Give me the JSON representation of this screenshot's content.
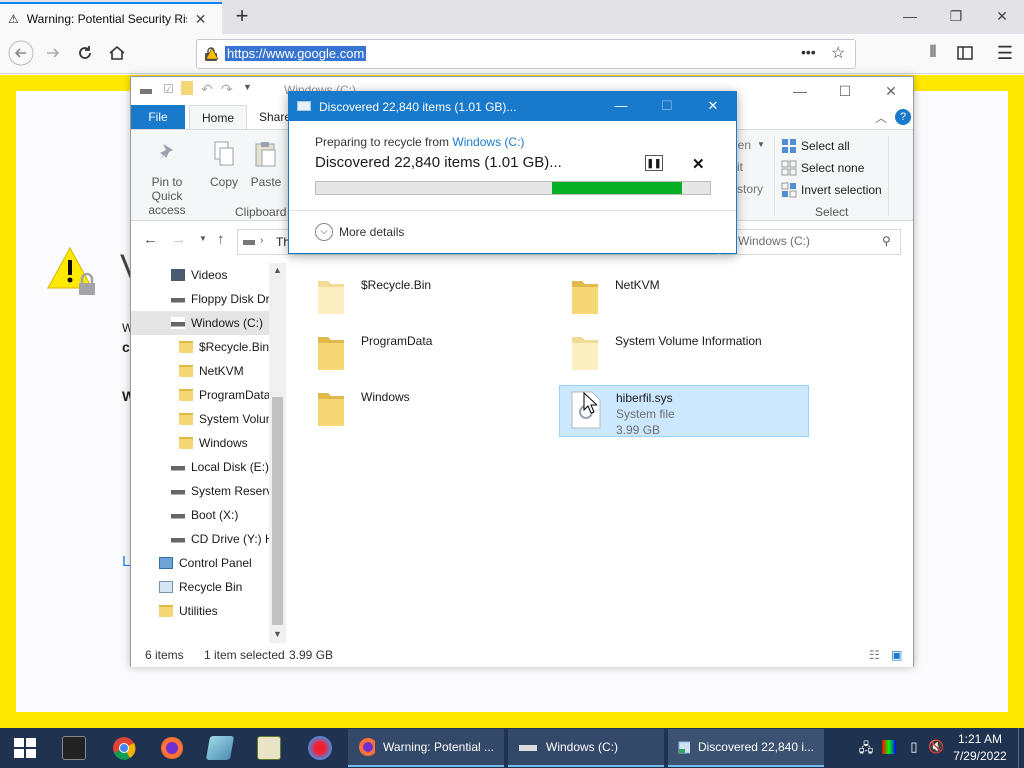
{
  "browser": {
    "tab_title": "Warning: Potential Security Risk Ahead",
    "url": "https://www.google.com"
  },
  "warning_page": {
    "fragments": [
      "V",
      "W",
      "c",
      "W",
      "L"
    ]
  },
  "explorer": {
    "title": "Windows (C:)",
    "ribbon_tabs": [
      "File",
      "Home",
      "Share"
    ],
    "clipboard": {
      "pin_label": "Pin to Quick access",
      "copy_label": "Copy",
      "paste_label": "Paste",
      "group_label": "Clipboard"
    },
    "select": {
      "select_all": "Select all",
      "select_none": "Select none",
      "invert": "Invert selection",
      "group_label": "Select",
      "partial_open": "pen",
      "partial_edit": "it",
      "partial_history": "story"
    },
    "address_partial": "Th",
    "search_placeholder": "h Windows (C:)",
    "tree": [
      {
        "label": "Videos",
        "icon": "videos-icon",
        "indent": 1
      },
      {
        "label": "Floppy Disk Dri",
        "icon": "floppy-icon",
        "indent": 1
      },
      {
        "label": "Windows (C:)",
        "icon": "drive-icon",
        "indent": 1,
        "selected": true
      },
      {
        "label": "$Recycle.Bin",
        "icon": "folder-icon",
        "indent": 2
      },
      {
        "label": "NetKVM",
        "icon": "folder-icon",
        "indent": 2
      },
      {
        "label": "ProgramData",
        "icon": "folder-icon",
        "indent": 2
      },
      {
        "label": "System Volun",
        "icon": "folder-icon",
        "indent": 2
      },
      {
        "label": "Windows",
        "icon": "folder-icon",
        "indent": 2
      },
      {
        "label": "Local Disk (E:)",
        "icon": "drive-icon",
        "indent": 1
      },
      {
        "label": "System Reserve",
        "icon": "drive-icon",
        "indent": 1
      },
      {
        "label": "Boot (X:)",
        "icon": "drive-icon",
        "indent": 1
      },
      {
        "label": "CD Drive (Y:) H",
        "icon": "cd-drive-icon",
        "indent": 1
      },
      {
        "label": "Control Panel",
        "icon": "control-panel-icon",
        "indent": 0
      },
      {
        "label": "Recycle Bin",
        "icon": "recycle-bin-icon",
        "indent": 0
      },
      {
        "label": "Utilities",
        "icon": "folder-icon",
        "indent": 0
      }
    ],
    "files": [
      {
        "name": "$Recycle.Bin",
        "meta1": "",
        "meta2": ""
      },
      {
        "name": "NetKVM",
        "meta1": "",
        "meta2": ""
      },
      {
        "name": "ProgramData",
        "meta1": "",
        "meta2": ""
      },
      {
        "name": "System Volume Information",
        "meta1": "",
        "meta2": ""
      },
      {
        "name": "Windows",
        "meta1": "",
        "meta2": ""
      },
      {
        "name": "hiberfil.sys",
        "meta1": "System file",
        "meta2": "3.99 GB"
      }
    ],
    "status": {
      "count": "6 items",
      "selected": "1 item selected",
      "size": "3.99 GB"
    }
  },
  "dialog": {
    "title": "Discovered 22,840 items (1.01 GB)...",
    "preparing_prefix": "Preparing to recycle from ",
    "preparing_link": "Windows (C:)",
    "main_text": "Discovered 22,840 items (1.01 GB)...",
    "progress_start": 0.6,
    "progress_end": 0.93,
    "more_details": "More details",
    "progress_color": "#06b025"
  },
  "taskbar": {
    "tasks": [
      {
        "label": "Warning: Potential ...",
        "icon": "firefox-icon"
      },
      {
        "label": "Windows (C:)",
        "icon": "drive-icon"
      },
      {
        "label": "Discovered 22,840 i...",
        "icon": "recycle-progress-icon"
      }
    ],
    "time": "1:21 AM",
    "date": "7/29/2022"
  }
}
